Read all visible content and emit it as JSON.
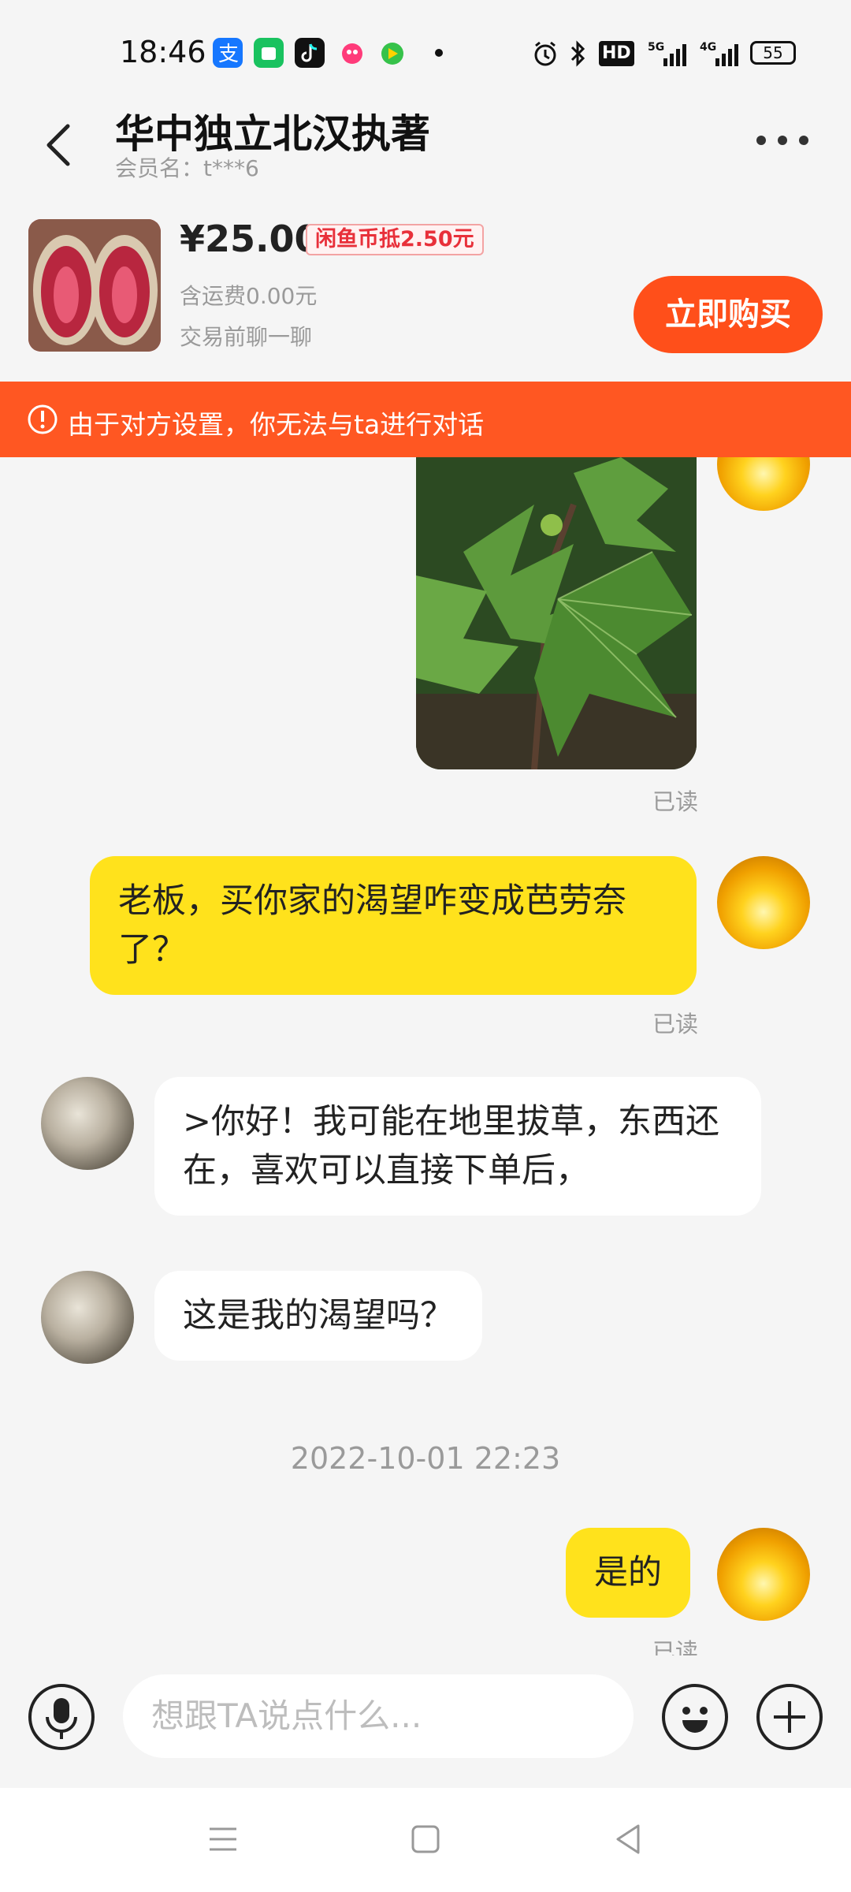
{
  "status_bar": {
    "time": "18:46",
    "battery": "55",
    "network1": "5G",
    "network2": "4G",
    "hd_label": "HD"
  },
  "header": {
    "title": "华中独立北汉执著",
    "member_label": "会员名：t***6"
  },
  "product": {
    "price": "¥25.00",
    "coin_discount": "闲鱼币抵2.50元",
    "shipping": "含运费0.00元",
    "chat_hint": "交易前聊一聊",
    "buy_button": "立即购买"
  },
  "notice": {
    "text": "由于对方设置，你无法与ta进行对话"
  },
  "messages": {
    "read_1": "已读",
    "me_1": "老板，买你家的渴望咋变成芭劳奈了？",
    "read_2": "已读",
    "other_1": ">你好！我可能在地里拔草，东西还在，喜欢可以直接下单后，",
    "other_2": "这是我的渴望吗？",
    "timestamp": "2022-10-01 22:23",
    "me_2": "是的",
    "read_3": "已读"
  },
  "input": {
    "placeholder": "想跟TA说点什么..."
  },
  "colors": {
    "accent_orange": "#ff5722",
    "bubble_yellow": "#ffe21c",
    "buy_button": "#ff4f1a"
  }
}
